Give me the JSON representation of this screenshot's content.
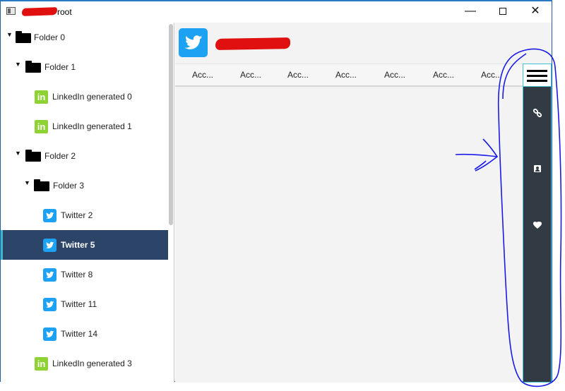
{
  "window": {
    "title_suffix": "root",
    "minimize_glyph": "—",
    "close_glyph": "✕"
  },
  "tree": {
    "items": [
      {
        "label": "Folder 0",
        "type": "folder",
        "expanded": true
      },
      {
        "label": "Folder 1",
        "type": "folder",
        "expanded": true
      },
      {
        "label": "LinkedIn generated 0",
        "type": "linkedin"
      },
      {
        "label": "LinkedIn generated 1",
        "type": "linkedin"
      },
      {
        "label": "Folder 2",
        "type": "folder",
        "expanded": true
      },
      {
        "label": "Folder 3",
        "type": "folder",
        "expanded": true
      },
      {
        "label": "Twitter 2",
        "type": "twitter"
      },
      {
        "label": "Twitter 5",
        "type": "twitter",
        "selected": true
      },
      {
        "label": "Twitter 8",
        "type": "twitter"
      },
      {
        "label": "Twitter 11",
        "type": "twitter"
      },
      {
        "label": "Twitter 14",
        "type": "twitter"
      },
      {
        "label": "LinkedIn generated 3",
        "type": "linkedin"
      }
    ],
    "expand_glyph": "▼",
    "linkedin_glyph": "in"
  },
  "tabs": [
    "Acc...",
    "Acc...",
    "Acc...",
    "Acc...",
    "Acc...",
    "Acc...",
    "Acc..."
  ],
  "side_panel": {
    "icons": [
      "link-icon",
      "contact-card-icon",
      "heart-icon"
    ]
  },
  "colors": {
    "selection": "#2b4468",
    "accent": "#40c2d6",
    "side_panel": "#323a44",
    "twitter": "#1da1f2",
    "linkedin": "#8ed233",
    "annotation": "#1a1ae6",
    "redaction": "#e01010"
  }
}
